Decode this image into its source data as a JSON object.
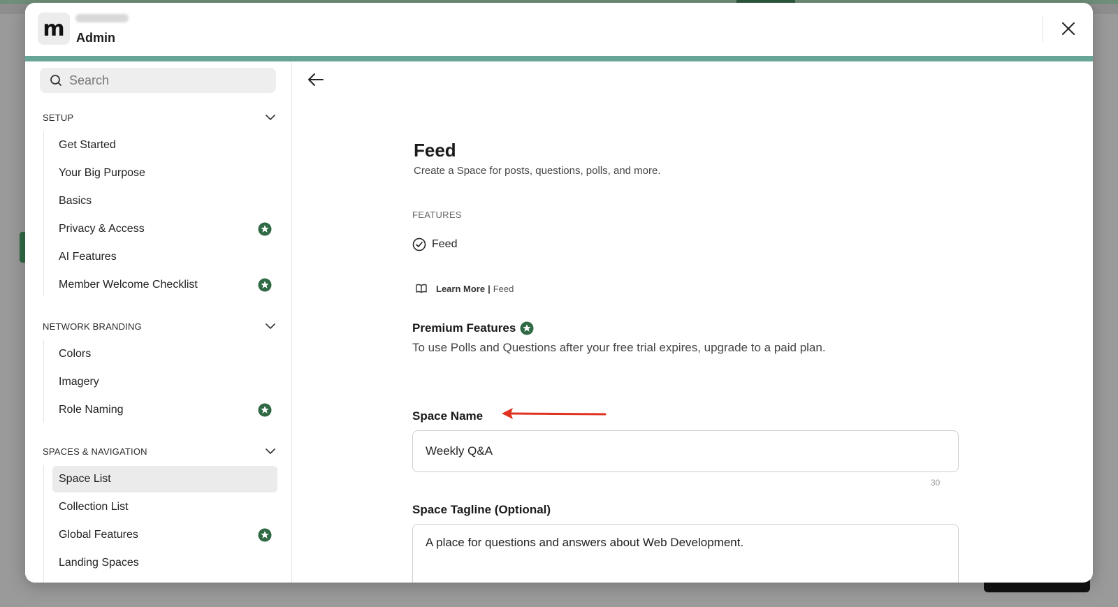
{
  "header": {
    "logo_letter": "m",
    "title": "Admin"
  },
  "sidebar": {
    "search_placeholder": "Search",
    "sections": [
      {
        "title": "SETUP",
        "items": [
          {
            "label": "Get Started",
            "premium": false
          },
          {
            "label": "Your Big Purpose",
            "premium": false
          },
          {
            "label": "Basics",
            "premium": false
          },
          {
            "label": "Privacy & Access",
            "premium": true
          },
          {
            "label": "AI Features",
            "premium": false
          },
          {
            "label": "Member Welcome Checklist",
            "premium": true
          }
        ]
      },
      {
        "title": "NETWORK BRANDING",
        "items": [
          {
            "label": "Colors",
            "premium": false
          },
          {
            "label": "Imagery",
            "premium": false
          },
          {
            "label": "Role Naming",
            "premium": true
          }
        ]
      },
      {
        "title": "SPACES & NAVIGATION",
        "items": [
          {
            "label": "Space List",
            "premium": false,
            "active": true
          },
          {
            "label": "Collection List",
            "premium": false
          },
          {
            "label": "Global Features",
            "premium": true
          },
          {
            "label": "Landing Spaces",
            "premium": false
          }
        ]
      }
    ]
  },
  "main": {
    "title": "Feed",
    "subtitle": "Create a Space for posts, questions, polls, and more.",
    "features_label": "FEATURES",
    "features": [
      "Feed"
    ],
    "learn_more": {
      "label": "Learn More",
      "separator": "|",
      "topic": "Feed"
    },
    "premium": {
      "title": "Premium Features",
      "description": "To use Polls and Questions after your free trial expires, upgrade to a paid plan."
    },
    "space_name": {
      "label": "Space Name",
      "value": "Weekly Q&A",
      "char_limit": "30"
    },
    "space_tagline": {
      "label": "Space Tagline (Optional)",
      "value": "A place for questions and answers about Web Development."
    }
  },
  "colors": {
    "accent_stripe": "#67a597",
    "premium_star": "#2f6a45",
    "annotation_arrow": "#e0321f"
  },
  "icons": {
    "close": "close-icon",
    "back": "arrow-left-icon",
    "search": "search-icon",
    "chevron": "chevron-down-icon",
    "premium": "star-badge-icon",
    "check": "check-circle-icon",
    "book": "book-open-icon"
  }
}
